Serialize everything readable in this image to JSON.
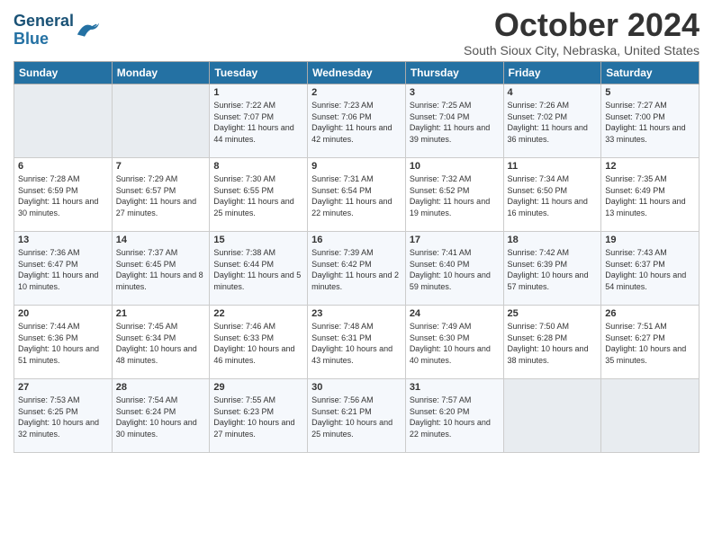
{
  "header": {
    "logo_line1": "General",
    "logo_line2": "Blue",
    "month_title": "October 2024",
    "location": "South Sioux City, Nebraska, United States"
  },
  "days_of_week": [
    "Sunday",
    "Monday",
    "Tuesday",
    "Wednesday",
    "Thursday",
    "Friday",
    "Saturday"
  ],
  "weeks": [
    [
      {
        "day": "",
        "sunrise": "",
        "sunset": "",
        "daylight": ""
      },
      {
        "day": "",
        "sunrise": "",
        "sunset": "",
        "daylight": ""
      },
      {
        "day": "1",
        "sunrise": "Sunrise: 7:22 AM",
        "sunset": "Sunset: 7:07 PM",
        "daylight": "Daylight: 11 hours and 44 minutes."
      },
      {
        "day": "2",
        "sunrise": "Sunrise: 7:23 AM",
        "sunset": "Sunset: 7:06 PM",
        "daylight": "Daylight: 11 hours and 42 minutes."
      },
      {
        "day": "3",
        "sunrise": "Sunrise: 7:25 AM",
        "sunset": "Sunset: 7:04 PM",
        "daylight": "Daylight: 11 hours and 39 minutes."
      },
      {
        "day": "4",
        "sunrise": "Sunrise: 7:26 AM",
        "sunset": "Sunset: 7:02 PM",
        "daylight": "Daylight: 11 hours and 36 minutes."
      },
      {
        "day": "5",
        "sunrise": "Sunrise: 7:27 AM",
        "sunset": "Sunset: 7:00 PM",
        "daylight": "Daylight: 11 hours and 33 minutes."
      }
    ],
    [
      {
        "day": "6",
        "sunrise": "Sunrise: 7:28 AM",
        "sunset": "Sunset: 6:59 PM",
        "daylight": "Daylight: 11 hours and 30 minutes."
      },
      {
        "day": "7",
        "sunrise": "Sunrise: 7:29 AM",
        "sunset": "Sunset: 6:57 PM",
        "daylight": "Daylight: 11 hours and 27 minutes."
      },
      {
        "day": "8",
        "sunrise": "Sunrise: 7:30 AM",
        "sunset": "Sunset: 6:55 PM",
        "daylight": "Daylight: 11 hours and 25 minutes."
      },
      {
        "day": "9",
        "sunrise": "Sunrise: 7:31 AM",
        "sunset": "Sunset: 6:54 PM",
        "daylight": "Daylight: 11 hours and 22 minutes."
      },
      {
        "day": "10",
        "sunrise": "Sunrise: 7:32 AM",
        "sunset": "Sunset: 6:52 PM",
        "daylight": "Daylight: 11 hours and 19 minutes."
      },
      {
        "day": "11",
        "sunrise": "Sunrise: 7:34 AM",
        "sunset": "Sunset: 6:50 PM",
        "daylight": "Daylight: 11 hours and 16 minutes."
      },
      {
        "day": "12",
        "sunrise": "Sunrise: 7:35 AM",
        "sunset": "Sunset: 6:49 PM",
        "daylight": "Daylight: 11 hours and 13 minutes."
      }
    ],
    [
      {
        "day": "13",
        "sunrise": "Sunrise: 7:36 AM",
        "sunset": "Sunset: 6:47 PM",
        "daylight": "Daylight: 11 hours and 10 minutes."
      },
      {
        "day": "14",
        "sunrise": "Sunrise: 7:37 AM",
        "sunset": "Sunset: 6:45 PM",
        "daylight": "Daylight: 11 hours and 8 minutes."
      },
      {
        "day": "15",
        "sunrise": "Sunrise: 7:38 AM",
        "sunset": "Sunset: 6:44 PM",
        "daylight": "Daylight: 11 hours and 5 minutes."
      },
      {
        "day": "16",
        "sunrise": "Sunrise: 7:39 AM",
        "sunset": "Sunset: 6:42 PM",
        "daylight": "Daylight: 11 hours and 2 minutes."
      },
      {
        "day": "17",
        "sunrise": "Sunrise: 7:41 AM",
        "sunset": "Sunset: 6:40 PM",
        "daylight": "Daylight: 10 hours and 59 minutes."
      },
      {
        "day": "18",
        "sunrise": "Sunrise: 7:42 AM",
        "sunset": "Sunset: 6:39 PM",
        "daylight": "Daylight: 10 hours and 57 minutes."
      },
      {
        "day": "19",
        "sunrise": "Sunrise: 7:43 AM",
        "sunset": "Sunset: 6:37 PM",
        "daylight": "Daylight: 10 hours and 54 minutes."
      }
    ],
    [
      {
        "day": "20",
        "sunrise": "Sunrise: 7:44 AM",
        "sunset": "Sunset: 6:36 PM",
        "daylight": "Daylight: 10 hours and 51 minutes."
      },
      {
        "day": "21",
        "sunrise": "Sunrise: 7:45 AM",
        "sunset": "Sunset: 6:34 PM",
        "daylight": "Daylight: 10 hours and 48 minutes."
      },
      {
        "day": "22",
        "sunrise": "Sunrise: 7:46 AM",
        "sunset": "Sunset: 6:33 PM",
        "daylight": "Daylight: 10 hours and 46 minutes."
      },
      {
        "day": "23",
        "sunrise": "Sunrise: 7:48 AM",
        "sunset": "Sunset: 6:31 PM",
        "daylight": "Daylight: 10 hours and 43 minutes."
      },
      {
        "day": "24",
        "sunrise": "Sunrise: 7:49 AM",
        "sunset": "Sunset: 6:30 PM",
        "daylight": "Daylight: 10 hours and 40 minutes."
      },
      {
        "day": "25",
        "sunrise": "Sunrise: 7:50 AM",
        "sunset": "Sunset: 6:28 PM",
        "daylight": "Daylight: 10 hours and 38 minutes."
      },
      {
        "day": "26",
        "sunrise": "Sunrise: 7:51 AM",
        "sunset": "Sunset: 6:27 PM",
        "daylight": "Daylight: 10 hours and 35 minutes."
      }
    ],
    [
      {
        "day": "27",
        "sunrise": "Sunrise: 7:53 AM",
        "sunset": "Sunset: 6:25 PM",
        "daylight": "Daylight: 10 hours and 32 minutes."
      },
      {
        "day": "28",
        "sunrise": "Sunrise: 7:54 AM",
        "sunset": "Sunset: 6:24 PM",
        "daylight": "Daylight: 10 hours and 30 minutes."
      },
      {
        "day": "29",
        "sunrise": "Sunrise: 7:55 AM",
        "sunset": "Sunset: 6:23 PM",
        "daylight": "Daylight: 10 hours and 27 minutes."
      },
      {
        "day": "30",
        "sunrise": "Sunrise: 7:56 AM",
        "sunset": "Sunset: 6:21 PM",
        "daylight": "Daylight: 10 hours and 25 minutes."
      },
      {
        "day": "31",
        "sunrise": "Sunrise: 7:57 AM",
        "sunset": "Sunset: 6:20 PM",
        "daylight": "Daylight: 10 hours and 22 minutes."
      },
      {
        "day": "",
        "sunrise": "",
        "sunset": "",
        "daylight": ""
      },
      {
        "day": "",
        "sunrise": "",
        "sunset": "",
        "daylight": ""
      }
    ]
  ]
}
